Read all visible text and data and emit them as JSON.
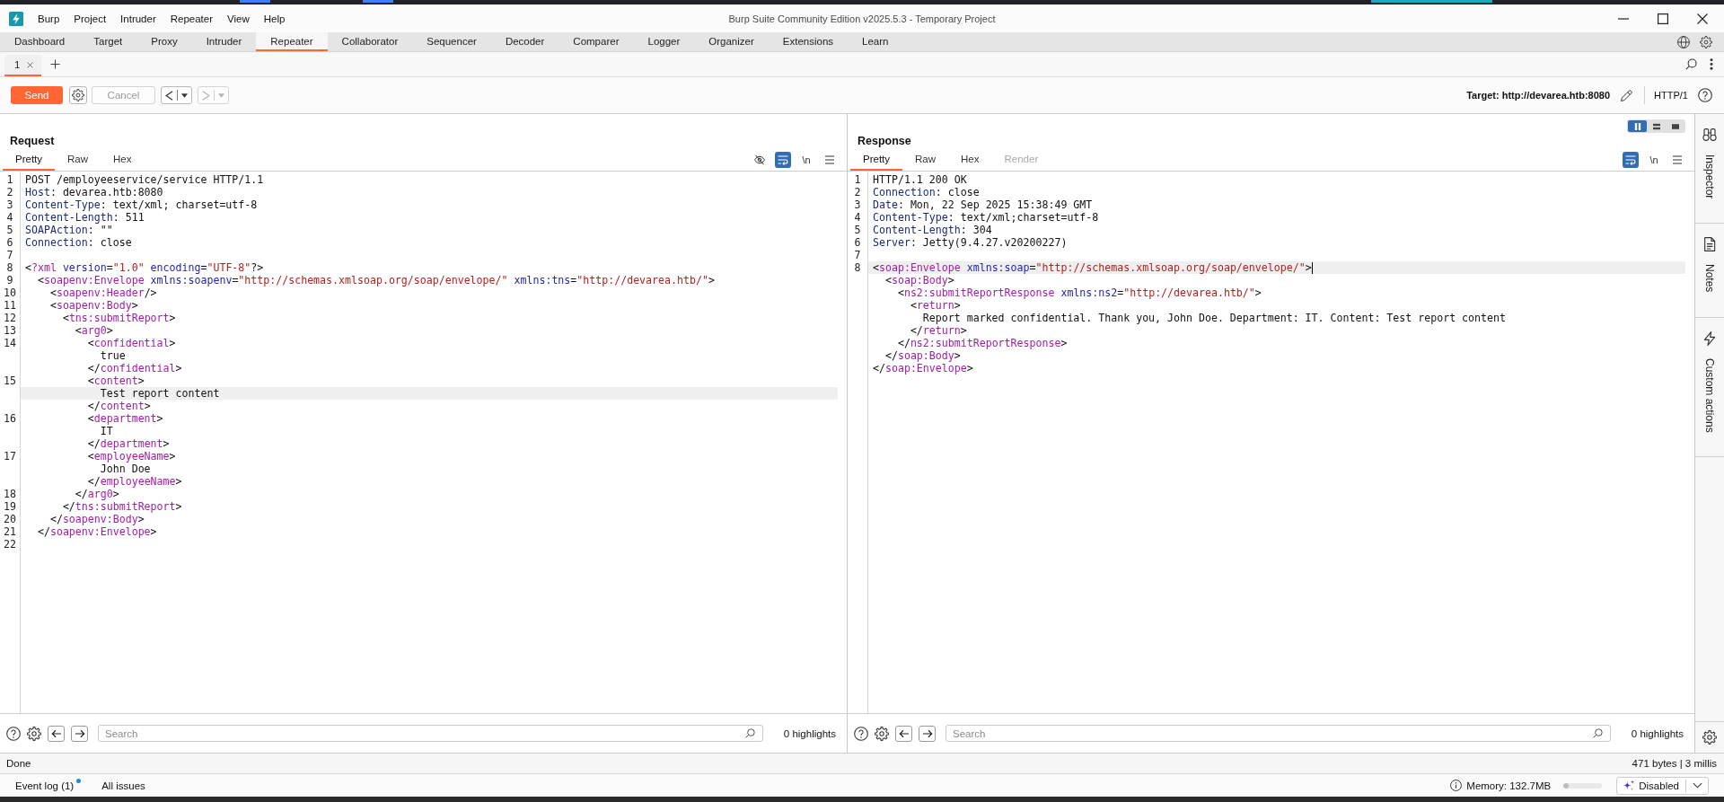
{
  "window": {
    "title": "Burp Suite Community Edition v2025.5.3 - Temporary Project",
    "menu": [
      "Burp",
      "Project",
      "Intruder",
      "Repeater",
      "View",
      "Help"
    ]
  },
  "tabs": [
    {
      "label": "Dashboard",
      "selected": false
    },
    {
      "label": "Target",
      "selected": false
    },
    {
      "label": "Proxy",
      "selected": false
    },
    {
      "label": "Intruder",
      "selected": false
    },
    {
      "label": "Repeater",
      "selected": true
    },
    {
      "label": "Collaborator",
      "selected": false
    },
    {
      "label": "Sequencer",
      "selected": false
    },
    {
      "label": "Decoder",
      "selected": false
    },
    {
      "label": "Comparer",
      "selected": false
    },
    {
      "label": "Logger",
      "selected": false
    },
    {
      "label": "Organizer",
      "selected": false
    },
    {
      "label": "Extensions",
      "selected": false
    },
    {
      "label": "Learn",
      "selected": false
    }
  ],
  "repeater_tabs": [
    {
      "label": "1",
      "selected": true
    }
  ],
  "toolbar": {
    "send": {
      "label": "Send",
      "disabled": false
    },
    "cancel": {
      "label": "Cancel",
      "disabled": true
    },
    "back": {
      "disabled": false
    },
    "forward": {
      "disabled": true
    },
    "target": "Target: http://devarea.htb:8080",
    "protocol": "HTTP/1"
  },
  "request": {
    "title": "Request",
    "view_tabs": [
      {
        "label": "Pretty",
        "selected": true,
        "disabled": false
      },
      {
        "label": "Raw",
        "selected": false,
        "disabled": false
      },
      {
        "label": "Hex",
        "selected": false,
        "disabled": false
      }
    ],
    "tools": [
      {
        "kind": "hide",
        "selected": false
      },
      {
        "kind": "wrap",
        "selected": true
      },
      {
        "kind": "newline",
        "label": "\\n",
        "selected": false
      },
      {
        "kind": "menu",
        "selected": false
      }
    ],
    "caret_visible": false,
    "lines": [
      {
        "number": "1",
        "rows": [
          {
            "current": false,
            "tokens": [
              {
                "kind": "plain",
                "text": "POST /employeeservice/service HTTP/1.1"
              }
            ]
          }
        ]
      },
      {
        "number": "2",
        "rows": [
          {
            "current": false,
            "tokens": [
              {
                "kind": "header",
                "text": "Host"
              },
              {
                "kind": "plain",
                "text": ": devarea.htb:8080"
              }
            ]
          }
        ]
      },
      {
        "number": "3",
        "rows": [
          {
            "current": false,
            "tokens": [
              {
                "kind": "header",
                "text": "Content-Type"
              },
              {
                "kind": "plain",
                "text": ": text/xml; charset=utf-8"
              }
            ]
          }
        ]
      },
      {
        "number": "4",
        "rows": [
          {
            "current": false,
            "tokens": [
              {
                "kind": "header",
                "text": "Content-Length"
              },
              {
                "kind": "plain",
                "text": ": 511"
              }
            ]
          }
        ]
      },
      {
        "number": "5",
        "rows": [
          {
            "current": false,
            "tokens": [
              {
                "kind": "header",
                "text": "SOAPAction"
              },
              {
                "kind": "plain",
                "text": ": \"\""
              }
            ]
          }
        ]
      },
      {
        "number": "6",
        "rows": [
          {
            "current": false,
            "tokens": [
              {
                "kind": "header",
                "text": "Connection"
              },
              {
                "kind": "plain",
                "text": ": close"
              }
            ]
          }
        ]
      },
      {
        "number": "7"
      },
      {
        "number": "8",
        "rows": [
          {
            "current": false,
            "tokens": [
              {
                "kind": "plain",
                "text": "<"
              },
              {
                "kind": "tag",
                "text": "?xml"
              },
              {
                "kind": "attr",
                "text": " version"
              },
              {
                "kind": "plain",
                "text": "="
              },
              {
                "kind": "value",
                "text": "\"1.0\""
              },
              {
                "kind": "attr",
                "text": " encoding"
              },
              {
                "kind": "plain",
                "text": "="
              },
              {
                "kind": "value",
                "text": "\"UTF-8\""
              },
              {
                "kind": "plain",
                "text": "?>"
              }
            ]
          }
        ]
      },
      {
        "number": "9",
        "rows": [
          {
            "current": false,
            "tokens": [
              {
                "kind": "plain",
                "text": "  <"
              },
              {
                "kind": "tag",
                "text": "soapenv:Envelope"
              },
              {
                "kind": "attr",
                "text": " xmlns:soapenv"
              },
              {
                "kind": "plain",
                "text": "="
              },
              {
                "kind": "value",
                "text": "\"http://schemas.xmlsoap.org/soap/envelope/\""
              },
              {
                "kind": "attr",
                "text": " xmlns:tns"
              },
              {
                "kind": "plain",
                "text": "="
              },
              {
                "kind": "value",
                "text": "\"http://devarea.htb/\""
              },
              {
                "kind": "plain",
                "text": ">"
              }
            ]
          }
        ]
      },
      {
        "number": "10",
        "rows": [
          {
            "current": false,
            "tokens": [
              {
                "kind": "plain",
                "text": "    <"
              },
              {
                "kind": "tag",
                "text": "soapenv:Header"
              },
              {
                "kind": "plain",
                "text": "/>"
              }
            ]
          }
        ]
      },
      {
        "number": "11",
        "rows": [
          {
            "current": false,
            "tokens": [
              {
                "kind": "plain",
                "text": "    <"
              },
              {
                "kind": "tag",
                "text": "soapenv:Body"
              },
              {
                "kind": "plain",
                "text": ">"
              }
            ]
          }
        ]
      },
      {
        "number": "12",
        "rows": [
          {
            "current": false,
            "tokens": [
              {
                "kind": "plain",
                "text": "      <"
              },
              {
                "kind": "tag",
                "text": "tns:submitReport"
              },
              {
                "kind": "plain",
                "text": ">"
              }
            ]
          }
        ]
      },
      {
        "number": "13",
        "rows": [
          {
            "current": false,
            "tokens": [
              {
                "kind": "plain",
                "text": "        <"
              },
              {
                "kind": "tag",
                "text": "arg0"
              },
              {
                "kind": "plain",
                "text": ">"
              }
            ]
          }
        ]
      },
      {
        "number": "14",
        "rows": [
          {
            "current": false,
            "tokens": [
              {
                "kind": "plain",
                "text": "          <"
              },
              {
                "kind": "tag",
                "text": "confidential"
              },
              {
                "kind": "plain",
                "text": ">"
              }
            ]
          },
          {
            "current": false,
            "tokens": [
              {
                "kind": "plain",
                "text": "            true"
              }
            ]
          },
          {
            "current": false,
            "tokens": [
              {
                "kind": "plain",
                "text": "          </"
              },
              {
                "kind": "tag",
                "text": "confidential"
              },
              {
                "kind": "plain",
                "text": ">"
              }
            ]
          }
        ]
      },
      {
        "number": "15",
        "rows": [
          {
            "current": false,
            "tokens": [
              {
                "kind": "plain",
                "text": "          <"
              },
              {
                "kind": "tag",
                "text": "content"
              },
              {
                "kind": "plain",
                "text": ">"
              }
            ]
          },
          {
            "current": true,
            "tokens": [
              {
                "kind": "plain",
                "text": "            Test report content"
              }
            ]
          },
          {
            "current": false,
            "tokens": [
              {
                "kind": "plain",
                "text": "          </"
              },
              {
                "kind": "tag",
                "text": "content"
              },
              {
                "kind": "plain",
                "text": ">"
              }
            ]
          }
        ]
      },
      {
        "number": "16",
        "rows": [
          {
            "current": false,
            "tokens": [
              {
                "kind": "plain",
                "text": "          <"
              },
              {
                "kind": "tag",
                "text": "department"
              },
              {
                "kind": "plain",
                "text": ">"
              }
            ]
          },
          {
            "current": false,
            "tokens": [
              {
                "kind": "plain",
                "text": "            IT"
              }
            ]
          },
          {
            "current": false,
            "tokens": [
              {
                "kind": "plain",
                "text": "          </"
              },
              {
                "kind": "tag",
                "text": "department"
              },
              {
                "kind": "plain",
                "text": ">"
              }
            ]
          }
        ]
      },
      {
        "number": "17",
        "rows": [
          {
            "current": false,
            "tokens": [
              {
                "kind": "plain",
                "text": "          <"
              },
              {
                "kind": "tag",
                "text": "employeeName"
              },
              {
                "kind": "plain",
                "text": ">"
              }
            ]
          },
          {
            "current": false,
            "tokens": [
              {
                "kind": "plain",
                "text": "            John Doe"
              }
            ]
          },
          {
            "current": false,
            "tokens": [
              {
                "kind": "plain",
                "text": "          </"
              },
              {
                "kind": "tag",
                "text": "employeeName"
              },
              {
                "kind": "plain",
                "text": ">"
              }
            ]
          }
        ]
      },
      {
        "number": "18",
        "rows": [
          {
            "current": false,
            "tokens": [
              {
                "kind": "plain",
                "text": "        </"
              },
              {
                "kind": "tag",
                "text": "arg0"
              },
              {
                "kind": "plain",
                "text": ">"
              }
            ]
          }
        ]
      },
      {
        "number": "19",
        "rows": [
          {
            "current": false,
            "tokens": [
              {
                "kind": "plain",
                "text": "      </"
              },
              {
                "kind": "tag",
                "text": "tns:submitReport"
              },
              {
                "kind": "plain",
                "text": ">"
              }
            ]
          }
        ]
      },
      {
        "number": "20",
        "rows": [
          {
            "current": false,
            "tokens": [
              {
                "kind": "plain",
                "text": "    </"
              },
              {
                "kind": "tag",
                "text": "soapenv:Body"
              },
              {
                "kind": "plain",
                "text": ">"
              }
            ]
          }
        ]
      },
      {
        "number": "21",
        "rows": [
          {
            "current": false,
            "tokens": [
              {
                "kind": "plain",
                "text": "  </"
              },
              {
                "kind": "tag",
                "text": "soapenv:Envelope"
              },
              {
                "kind": "plain",
                "text": ">"
              }
            ]
          }
        ]
      },
      {
        "number": "22"
      }
    ],
    "search": {
      "placeholder": "Search"
    },
    "highlights": "0 highlights"
  },
  "response": {
    "title": "Response",
    "layout_buttons": [
      {
        "kind": "columns",
        "selected": true
      },
      {
        "kind": "rows",
        "selected": false
      },
      {
        "kind": "single",
        "selected": false
      }
    ],
    "view_tabs": [
      {
        "label": "Pretty",
        "selected": true,
        "disabled": false
      },
      {
        "label": "Raw",
        "selected": false,
        "disabled": false
      },
      {
        "label": "Hex",
        "selected": false,
        "disabled": false
      },
      {
        "label": "Render",
        "selected": false,
        "disabled": true
      }
    ],
    "tools": [
      {
        "kind": "wrap",
        "selected": true
      },
      {
        "kind": "newline",
        "label": "\\n",
        "selected": false
      },
      {
        "kind": "menu",
        "selected": false
      }
    ],
    "caret_visible": true,
    "lines": [
      {
        "number": "1",
        "rows": [
          {
            "current": false,
            "tokens": [
              {
                "kind": "plain",
                "text": "HTTP/1.1 200 OK"
              }
            ]
          }
        ]
      },
      {
        "number": "2",
        "rows": [
          {
            "current": false,
            "tokens": [
              {
                "kind": "header",
                "text": "Connection"
              },
              {
                "kind": "plain",
                "text": ": close"
              }
            ]
          }
        ]
      },
      {
        "number": "3",
        "rows": [
          {
            "current": false,
            "tokens": [
              {
                "kind": "header",
                "text": "Date"
              },
              {
                "kind": "plain",
                "text": ": Mon, 22 Sep 2025 15:38:49 GMT"
              }
            ]
          }
        ]
      },
      {
        "number": "4",
        "rows": [
          {
            "current": false,
            "tokens": [
              {
                "kind": "header",
                "text": "Content-Type"
              },
              {
                "kind": "plain",
                "text": ": text/xml;charset=utf-8"
              }
            ]
          }
        ]
      },
      {
        "number": "5",
        "rows": [
          {
            "current": false,
            "tokens": [
              {
                "kind": "header",
                "text": "Content-Length"
              },
              {
                "kind": "plain",
                "text": ": 304"
              }
            ]
          }
        ]
      },
      {
        "number": "6",
        "rows": [
          {
            "current": false,
            "tokens": [
              {
                "kind": "header",
                "text": "Server"
              },
              {
                "kind": "plain",
                "text": ": Jetty(9.4.27.v20200227)"
              }
            ]
          }
        ]
      },
      {
        "number": "7"
      },
      {
        "number": "8",
        "rows": [
          {
            "current": true,
            "tokens": [
              {
                "kind": "plain",
                "text": "<"
              },
              {
                "kind": "tag",
                "text": "soap:Envelope"
              },
              {
                "kind": "attr",
                "text": " xmlns:soap"
              },
              {
                "kind": "plain",
                "text": "="
              },
              {
                "kind": "value",
                "text": "\"http://schemas.xmlsoap.org/soap/envelope/\""
              },
              {
                "kind": "plain",
                "text": ">"
              }
            ]
          },
          {
            "current": false,
            "tokens": [
              {
                "kind": "plain",
                "text": "  <"
              },
              {
                "kind": "tag",
                "text": "soap:Body"
              },
              {
                "kind": "plain",
                "text": ">"
              }
            ]
          },
          {
            "current": false,
            "tokens": [
              {
                "kind": "plain",
                "text": "    <"
              },
              {
                "kind": "tag",
                "text": "ns2:submitReportResponse"
              },
              {
                "kind": "attr",
                "text": " xmlns:ns2"
              },
              {
                "kind": "plain",
                "text": "="
              },
              {
                "kind": "value",
                "text": "\"http://devarea.htb/\""
              },
              {
                "kind": "plain",
                "text": ">"
              }
            ]
          },
          {
            "current": false,
            "tokens": [
              {
                "kind": "plain",
                "text": "      <"
              },
              {
                "kind": "tag",
                "text": "return"
              },
              {
                "kind": "plain",
                "text": ">"
              }
            ]
          },
          {
            "current": false,
            "tokens": [
              {
                "kind": "plain",
                "text": "        Report marked confidential. Thank you, John Doe. Department: IT. Content: Test report content"
              }
            ]
          },
          {
            "current": false,
            "tokens": [
              {
                "kind": "plain",
                "text": "      </"
              },
              {
                "kind": "tag",
                "text": "return"
              },
              {
                "kind": "plain",
                "text": ">"
              }
            ]
          },
          {
            "current": false,
            "tokens": [
              {
                "kind": "plain",
                "text": "    </"
              },
              {
                "kind": "tag",
                "text": "ns2:submitReportResponse"
              },
              {
                "kind": "plain",
                "text": ">"
              }
            ]
          },
          {
            "current": false,
            "tokens": [
              {
                "kind": "plain",
                "text": "  </"
              },
              {
                "kind": "tag",
                "text": "soap:Body"
              },
              {
                "kind": "plain",
                "text": ">"
              }
            ]
          },
          {
            "current": false,
            "tokens": [
              {
                "kind": "plain",
                "text": "</"
              },
              {
                "kind": "tag",
                "text": "soap:Envelope"
              },
              {
                "kind": "plain",
                "text": ">"
              }
            ]
          }
        ]
      }
    ],
    "search": {
      "placeholder": "Search"
    },
    "highlights": "0 highlights"
  },
  "sidebar": {
    "items": [
      {
        "kind": "inspector",
        "label": "Inspector"
      },
      {
        "kind": "notes",
        "label": "Notes"
      },
      {
        "kind": "actions",
        "label": "Custom actions"
      }
    ]
  },
  "status": {
    "message": "Done",
    "stats": "471 bytes | 3 millis"
  },
  "bottom_bar": {
    "event_log": {
      "label": "Event log (1)",
      "unread": true
    },
    "issues": "All issues",
    "memory": {
      "label": "Memory: 132.7MB",
      "level": 0.14
    },
    "ai": {
      "label": "Disabled"
    }
  }
}
